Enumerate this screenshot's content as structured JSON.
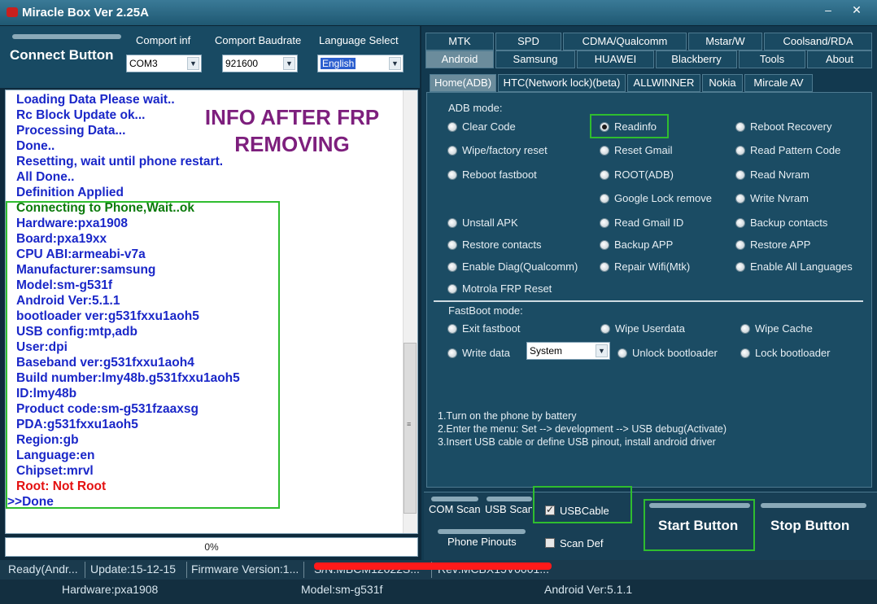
{
  "window": {
    "title": "Miracle Box Ver 2.25A",
    "minimize": "–",
    "close": "✕"
  },
  "connect": {
    "label": "Connect Button"
  },
  "comport": {
    "label": "Comport inf",
    "value": "COM3"
  },
  "baudrate": {
    "label": "Comport Baudrate",
    "value": "921600"
  },
  "language": {
    "label": "Language Select",
    "value": "English"
  },
  "log": {
    "overlay_line1": "INFO AFTER FRP",
    "overlay_line2": "REMOVING",
    "lines": [
      "Loading Data Please wait..",
      "Rc Block Update ok...",
      "Processing Data...",
      "Done..",
      "Resetting, wait until phone restart.",
      "All Done..",
      "Definition Applied",
      "Connecting to Phone,Wait..ok",
      "Hardware:pxa1908",
      "Board:pxa19xx",
      "CPU ABI:armeabi-v7a",
      "Manufacturer:samsung",
      "Model:sm-g531f",
      "Android Ver:5.1.1",
      "bootloader ver:g531fxxu1aoh5",
      "USB config:mtp,adb",
      "User:dpi",
      "Baseband ver:g531fxxu1aoh4",
      "Build number:lmy48b.g531fxxu1aoh5",
      "ID:lmy48b",
      "Product code:sm-g531fzaaxsg",
      "PDA:g531fxxu1aoh5",
      "Region:gb",
      "Language:en",
      "Chipset:mrvl",
      "Root:  Not Root",
      ">>Done"
    ]
  },
  "progress": {
    "value": 0,
    "text": "0%"
  },
  "status": {
    "ready": "Ready(Andr...",
    "update": "Update:15-12-15",
    "firmware": "Firmware Version:1...",
    "redacted1": "S/N:MBCM12022S...",
    "redacted2": "Rev:MCBX15V0001...",
    "hardware": "Hardware:pxa1908",
    "model": "Model:sm-g531f",
    "android": "Android Ver:5.1.1"
  },
  "tabs_row1": [
    "MTK",
    "SPD",
    "CDMA/Qualcomm",
    "Mstar/W",
    "Coolsand/RDA"
  ],
  "tabs_row2": [
    "Android",
    "Samsung",
    "HUAWEI",
    "Blackberry",
    "Tools",
    "About"
  ],
  "subtabs": [
    "Home(ADB)",
    "HTC(Network lock)(beta)",
    "ALLWINNER",
    "Nokia",
    "Mircale AV"
  ],
  "adb": {
    "label": "ADB mode:",
    "options": [
      "Clear Code",
      "Readinfo",
      "Reboot Recovery",
      "Wipe/factory reset",
      "Reset Gmail",
      "Read Pattern Code",
      "Reboot fastboot",
      "ROOT(ADB)",
      "Read Nvram",
      "Google Lock remove",
      "Write Nvram",
      "Unstall APK",
      "Read Gmail ID",
      "Backup contacts",
      "Restore contacts",
      "Backup APP",
      "Restore APP",
      "Enable Diag(Qualcomm)",
      "Repair Wifi(Mtk)",
      "Enable All Languages",
      "Motrola FRP Reset"
    ]
  },
  "fastboot": {
    "label": "FastBoot mode:",
    "options": [
      "Exit fastboot",
      "Wipe Userdata",
      "Wipe Cache",
      "Write data",
      "Unlock bootloader",
      "Lock bootloader"
    ],
    "partition": "System"
  },
  "instructions": [
    "1.Turn on the phone by battery",
    "2.Enter the menu: Set --> development --> USB debug(Activate)",
    "3.Insert USB cable or define USB pinout, install android driver"
  ],
  "bottom": {
    "com_scan": "COM Scan",
    "usb_scan": "USB Scan",
    "usb_cable": "USBCable",
    "phone_pinouts": "Phone Pinouts",
    "scan_def": "Scan Def",
    "start": "Start Button",
    "stop": "Stop Button"
  }
}
